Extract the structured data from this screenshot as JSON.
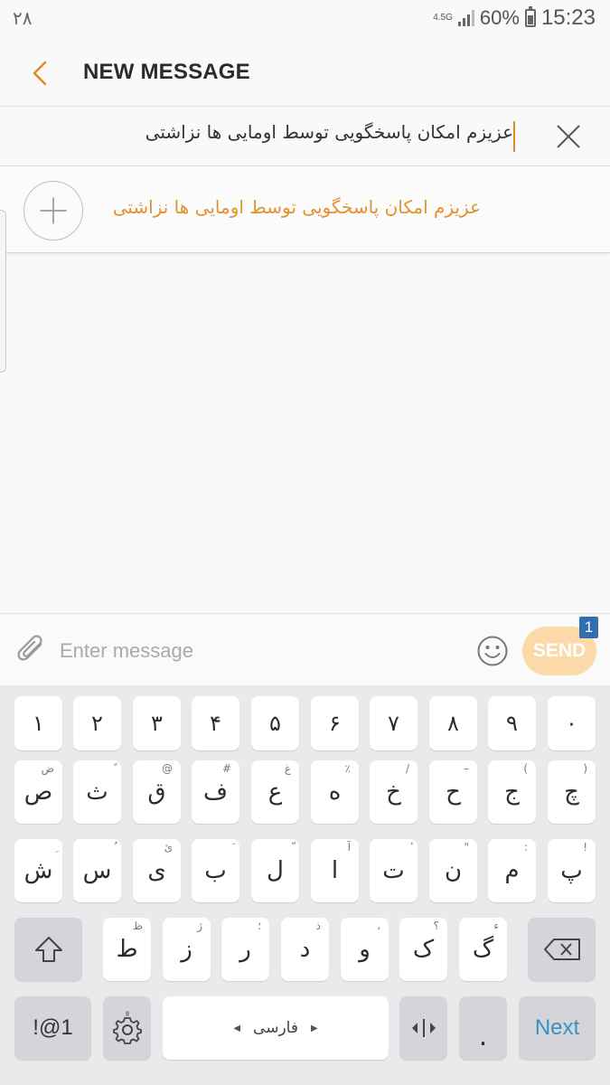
{
  "status_bar": {
    "left_text": "۲۸",
    "network": "4.5G",
    "battery_percent": "60%",
    "time": "15:23"
  },
  "header": {
    "title": "NEW MESSAGE",
    "back_icon": "chevron-left-icon"
  },
  "recipient": {
    "value": "عزیزم امکان پاسخگویی توسط اومایی ها نزاشتی",
    "clear_icon": "close-icon"
  },
  "suggestion": {
    "name": "عزیزم امکان پاسخگویی توسط اومایی ها نزاشتی",
    "add_icon": "plus-icon"
  },
  "compose": {
    "placeholder": "Enter message",
    "send_label": "SEND",
    "send_badge": "1",
    "attach_icon": "paperclip-icon",
    "emoji_icon": "smiley-icon"
  },
  "keyboard": {
    "numbers": [
      "۱",
      "۲",
      "۳",
      "۴",
      "۵",
      "۶",
      "۷",
      "۸",
      "۹",
      "۰"
    ],
    "row1": [
      {
        "main": "ص",
        "hint": "ض"
      },
      {
        "main": "ث",
        "hint": "ً"
      },
      {
        "main": "ق",
        "hint": "@"
      },
      {
        "main": "ف",
        "hint": "#"
      },
      {
        "main": "ع",
        "hint": "غ"
      },
      {
        "main": "ه",
        "hint": "٪"
      },
      {
        "main": "خ",
        "hint": "/"
      },
      {
        "main": "ح",
        "hint": "–"
      },
      {
        "main": "ج",
        "hint": "("
      },
      {
        "main": "چ",
        "hint": ")"
      }
    ],
    "row2": [
      {
        "main": "ش",
        "hint": "ِ"
      },
      {
        "main": "س",
        "hint": "ُ"
      },
      {
        "main": "ی",
        "hint": "ئ"
      },
      {
        "main": "ب",
        "hint": "َ"
      },
      {
        "main": "ل",
        "hint": "ّ"
      },
      {
        "main": "ا",
        "hint": "آ"
      },
      {
        "main": "ت",
        "hint": "ٔ"
      },
      {
        "main": "ن",
        "hint": "\""
      },
      {
        "main": "م",
        "hint": ":"
      },
      {
        "main": "پ",
        "hint": "!"
      }
    ],
    "row3": [
      {
        "main": "ط",
        "hint": "ظ"
      },
      {
        "main": "ز",
        "hint": "ژ"
      },
      {
        "main": "ر",
        "hint": "؛"
      },
      {
        "main": "د",
        "hint": "ذ"
      },
      {
        "main": "و",
        "hint": "،"
      },
      {
        "main": "ک",
        "hint": "؟"
      },
      {
        "main": "گ",
        "hint": "ء"
      }
    ],
    "shift_icon": "shift-arrow-icon",
    "backspace_icon": "backspace-icon",
    "symbols_label": "!@1",
    "settings_icon": "gear-icon",
    "space_label": "فارسی",
    "cursor_icon": "cursor-control-icon",
    "period_label": ".",
    "next_label": "Next"
  }
}
